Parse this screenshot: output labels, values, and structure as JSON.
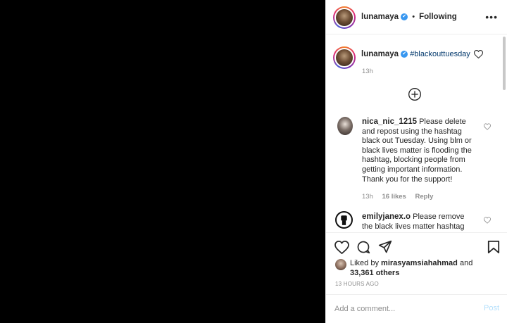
{
  "header": {
    "username": "lunamaya",
    "verified_glyph": "✔",
    "separator": "•",
    "follow_status": "Following",
    "more_label": "•••"
  },
  "caption": {
    "username": "lunamaya",
    "text": "#blackouttuesday",
    "time": "13h"
  },
  "load_more_icon": "plus-circle-icon",
  "comments": [
    {
      "username": "nica_nic_1215",
      "text": "Please delete and repost using the hashtag black out Tuesday. Using blm or black lives matter is flooding the hashtag, blocking people from getting important information. Thank you for the support!",
      "time": "13h",
      "likes": "16 likes",
      "reply": "Reply"
    },
    {
      "username": "emilyjanex.o",
      "text": "Please remove the black lives matter hashtag and",
      "time": "",
      "likes": "",
      "reply": ""
    }
  ],
  "actions": {
    "liked_by_prefix": "Liked by",
    "liked_by_user": "mirasyamsiahahmad",
    "liked_by_and": "and",
    "others": "33,361 others",
    "timestamp": "13 HOURS AGO"
  },
  "add_comment": {
    "placeholder": "Add a comment...",
    "post_label": "Post"
  },
  "colors": {
    "link": "#00376b",
    "verified": "#3897f0",
    "post_disabled": "#b2dffc",
    "muted": "#8e8e8e"
  }
}
